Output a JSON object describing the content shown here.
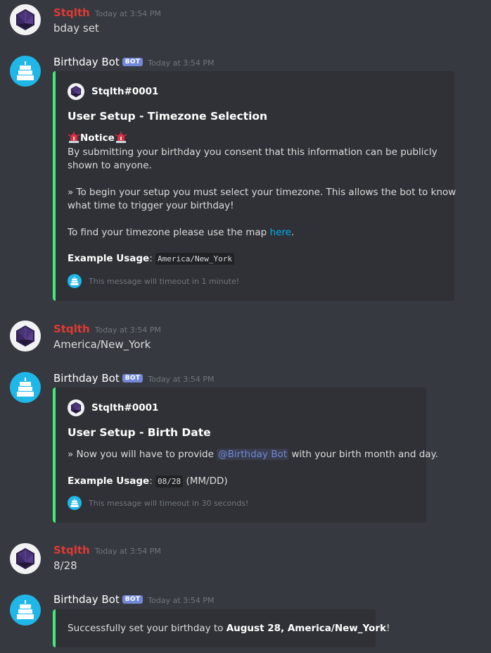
{
  "users": {
    "stqlth": {
      "name": "Stqlth",
      "tag": "Stqlth#0001"
    },
    "bot": {
      "name": "Birthday Bot",
      "badge": "BOT"
    }
  },
  "messages": [
    {
      "timestamp": "Today at 3:54 PM",
      "text": "bday set"
    },
    {
      "timestamp": "Today at 3:54 PM",
      "embed": {
        "author": "Stqlth#0001",
        "title": "User Setup - Timezone Selection",
        "notice": "Notice",
        "consent": "By submitting your birthday you consent that this information can be publicly shown to anyone.",
        "step_line1": "» To begin your setup you must select your timezone. This allows the bot to know",
        "step_line2": "what time to trigger your birthday!",
        "map_text": "To find your timezone please use the map ",
        "map_link": "here",
        "map_end": ".",
        "example_label": "Example Usage",
        "example_value": "America/New_York",
        "footer": "This message will timeout in 1 minute!"
      }
    },
    {
      "timestamp": "Today at 3:54 PM",
      "text": "America/New_York"
    },
    {
      "timestamp": "Today at 3:54 PM",
      "embed": {
        "author": "Stqlth#0001",
        "title": "User Setup - Birth Date",
        "step_pre": "» Now you will have to provide ",
        "mention": "@Birthday Bot",
        "step_post": " with your birth month and day.",
        "example_label": "Example Usage",
        "example_value": "08/28",
        "example_suffix": "(MM/DD)",
        "footer": "This message will timeout in 30 seconds!"
      }
    },
    {
      "timestamp": "Today at 3:54 PM",
      "text": "8/28"
    },
    {
      "timestamp": "Today at 3:54 PM",
      "embed": {
        "pre": "Successfully set your birthday to ",
        "bold": "August 28, America/New_York",
        "post": "!"
      }
    }
  ],
  "colors": {
    "background": "#36393f",
    "embed_bg": "#2f3136",
    "embed_border": "#43e97b",
    "stqlth_name": "#e03a35",
    "link": "#00b0f4",
    "badge": "#7289da"
  },
  "icons": {
    "user_avatar": "d20-dice-icon",
    "bot_avatar": "birthday-cake-icon",
    "notice": "siren-icon"
  }
}
